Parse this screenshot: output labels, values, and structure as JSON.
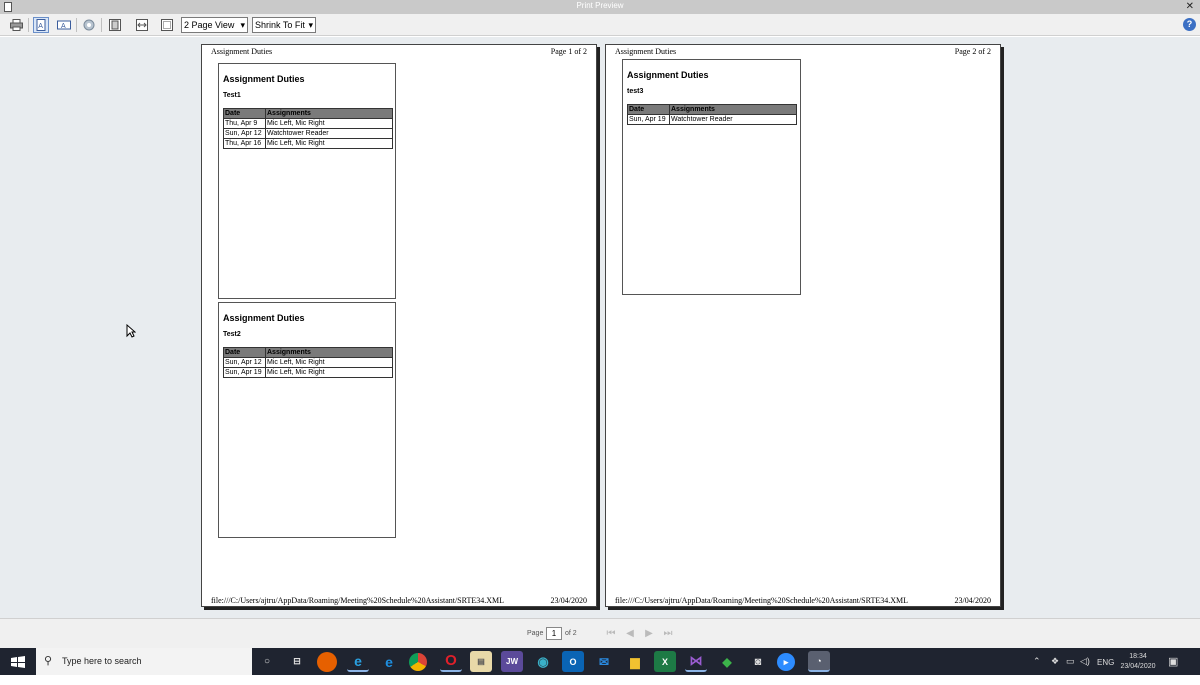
{
  "window": {
    "title": "Print Preview"
  },
  "toolbar": {
    "view_select": "2 Page View",
    "fit_select": "Shrink To Fit",
    "help": "?"
  },
  "pages": [
    {
      "header_left": "Assignment Duties",
      "header_right": "Page 1 of 2",
      "footer_left": "file:///C:/Users/ajtru/AppData/Roaming/Meeting%20Schedule%20Assistant/SRTE34.XML",
      "footer_right": "23/04/2020",
      "cards": [
        {
          "title": "Assignment Duties",
          "subtitle": "Test1",
          "columns": [
            "Date",
            "Assignments"
          ],
          "rows": [
            [
              "Thu, Apr 9",
              "Mic Left, Mic Right"
            ],
            [
              "Sun, Apr 12",
              "Watchtower Reader"
            ],
            [
              "Thu, Apr 16",
              "Mic Left, Mic Right"
            ]
          ]
        },
        {
          "title": "Assignment Duties",
          "subtitle": "Test2",
          "columns": [
            "Date",
            "Assignments"
          ],
          "rows": [
            [
              "Sun, Apr 12",
              "Mic Left, Mic Right"
            ],
            [
              "Sun, Apr 19",
              "Mic Left, Mic Right"
            ]
          ]
        }
      ]
    },
    {
      "header_left": "Assignment Duties",
      "header_right": "Page 2 of 2",
      "footer_left": "file:///C:/Users/ajtru/AppData/Roaming/Meeting%20Schedule%20Assistant/SRTE34.XML",
      "footer_right": "23/04/2020",
      "cards": [
        {
          "title": "Assignment Duties",
          "subtitle": "test3",
          "columns": [
            "Date",
            "Assignments"
          ],
          "rows": [
            [
              "Sun, Apr 19",
              "Watchtower Reader"
            ]
          ]
        }
      ]
    }
  ],
  "navigation": {
    "page_label": "Page",
    "page_value": "1",
    "of_label": "of 2"
  },
  "taskbar": {
    "search_placeholder": "Type here to search",
    "apps": [
      "task-view",
      "firefox",
      "ie",
      "edge",
      "chrome",
      "opera",
      "notepad",
      "jw-library",
      "explorer",
      "outlook",
      "mail",
      "file-explorer",
      "excel",
      "visual-studio",
      "help",
      "camera",
      "zoom",
      "msa"
    ],
    "language": "ENG",
    "time": "18:34",
    "date": "23/04/2020"
  }
}
